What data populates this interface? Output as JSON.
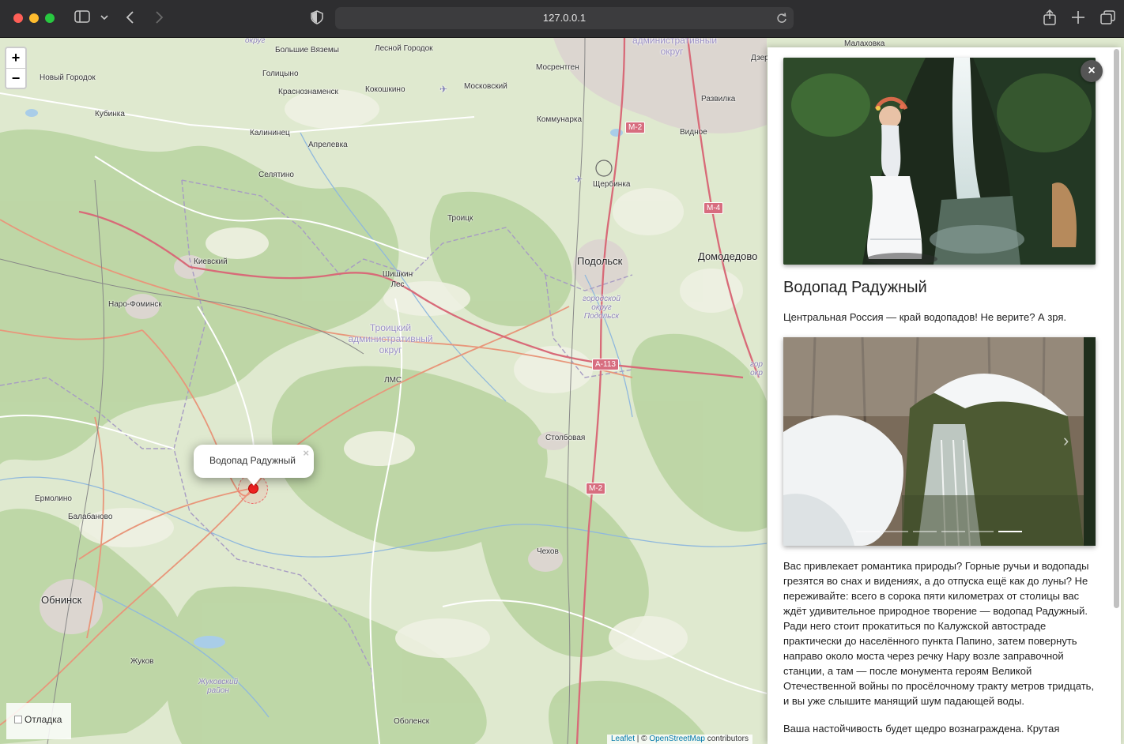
{
  "browser": {
    "url": "127.0.0.1"
  },
  "map": {
    "zoom_in": "+",
    "zoom_out": "−",
    "labels": {
      "bolshie_vyazemy": "Большие Вяземы",
      "golitsyno": "Голицыно",
      "lesnoy_gorodok": "Лесной Городок",
      "novy_gorodok": "Новый Городок",
      "krasnoznamensk": "Краснознаменск",
      "kokoshkino": "Кокошкино",
      "moskovsky": "Московский",
      "mosrentgen": "Мосрентген",
      "razvilka": "Развилка",
      "kubinka": "Кубинка",
      "kommunarka": "Коммунарка",
      "kalininets": "Калининец",
      "aprelevka": "Апрелевка",
      "vidnoe": "Видное",
      "selyatino": "Селятино",
      "shcherbinka": "Щербинка",
      "troitsk": "Троицк",
      "kievsky": "Киевский",
      "podolsk": "Подольск",
      "domodedovo": "Домодедово",
      "shishkin_les": "Шишкин Лес",
      "naro_fominsk": "Наро-Фоминск",
      "podolsk_okrug": "городской округ Подольск",
      "troitsky_okrug": "Троицкий административный округ",
      "lms": "ЛМС",
      "stolbovaya": "Столбовая",
      "ermolino": "Ермолино",
      "balabanovo": "Балабаново",
      "chekhov": "Чехов",
      "obninsk": "Обнинск",
      "zhukov": "Жуков",
      "zhukovsky_rayon": "Жуковский район",
      "obolensk": "Оболенск",
      "malakhovka": "Малаховка",
      "dzer": "Дзер",
      "okrug_top": "округ",
      "admin_okrug_top": "административный округ",
      "gor_okrug_right": "гор окр"
    },
    "shields": {
      "m2_top": "М-2",
      "m4": "М-4",
      "a113": "А-113",
      "m2_bottom": "М-2"
    },
    "popup": {
      "title": "Водопад Радужный",
      "close": "×"
    },
    "debug_label": "Отладка",
    "attribution": {
      "leaflet": "Leaflet",
      "sep": " | © ",
      "osm": "OpenStreetMap",
      "contrib": " contributors"
    }
  },
  "panel": {
    "close": "×",
    "title": "Водопад Радужный",
    "lead": "Центральная Россия — край водопадов! Не верите? А зря.",
    "gallery": {
      "slide_count": 6,
      "active_slide": 6,
      "next_icon": "›"
    },
    "body": "Вас привлекает романтика природы? Горные ручьи и водопады грезятся во снах и видениях, а до отпуска ещё как до луны? Не переживайте: всего в сорока пяти километрах от столицы вас ждёт удивительное природное творение — водопад Радужный. Ради него стоит прокатиться по Калужской автостраде практически до населённого пункта Папино, затем повернуть направо около моста через речку Нару возле заправочной станции, а там — после монумента героям Великой Отечественной войны по просёлочному тракту метров тридцать, и вы уже слышите манящий шум падающей воды.",
    "body2": "Ваша настойчивость будет щедро вознаграждена. Крутая"
  }
}
